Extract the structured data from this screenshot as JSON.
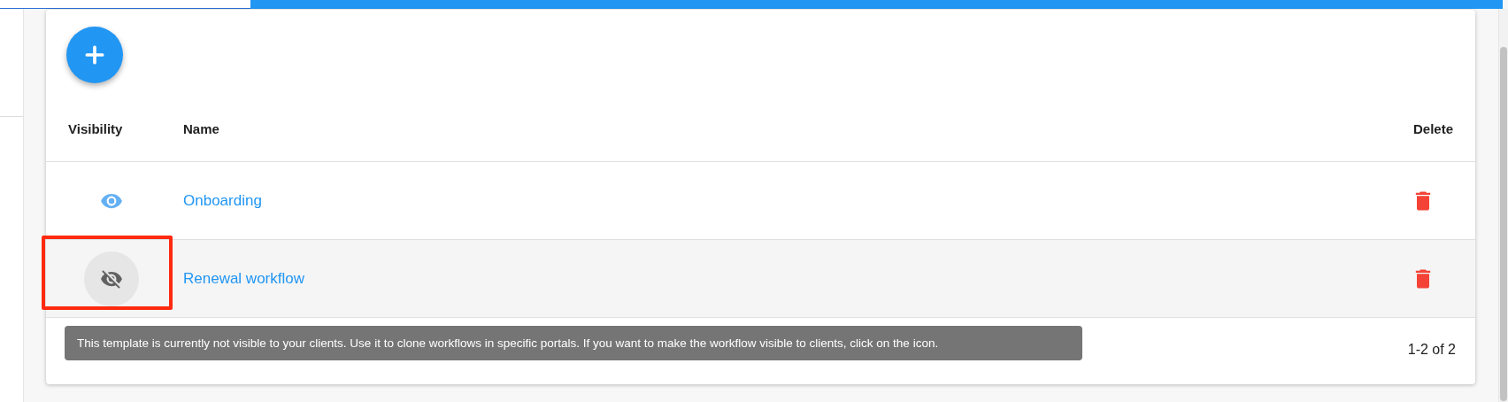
{
  "add_button": {
    "kind": "fab"
  },
  "table": {
    "columns": [
      "Visibility",
      "Name",
      "Delete"
    ],
    "rows": [
      {
        "visible": true,
        "name": "Onboarding",
        "hovered": false,
        "annotated": false
      },
      {
        "visible": false,
        "name": "Renewal workflow",
        "hovered": true,
        "annotated": true
      }
    ]
  },
  "tooltip": "This template is currently not visible to your clients. Use it to clone workflows in specific portals. If you want to make the workflow visible to clients, click on the icon.",
  "pagination": "1-2 of 2"
}
